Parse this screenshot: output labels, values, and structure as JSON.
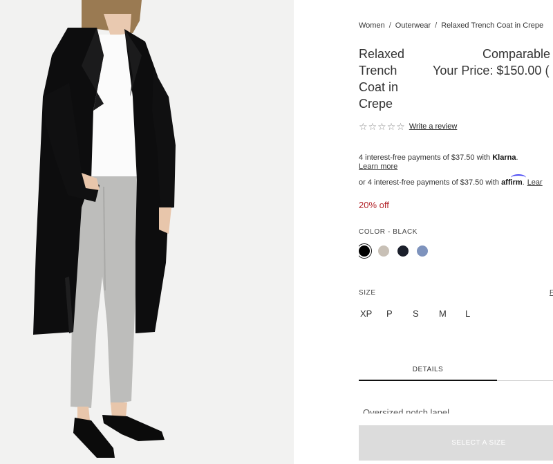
{
  "breadcrumb": {
    "items": [
      "Women",
      "Outerwear",
      "Relaxed Trench Coat in Crepe"
    ],
    "separator": "/"
  },
  "product": {
    "title": "Relaxed Trench Coat in Crepe",
    "comparable_label": "Comparable",
    "your_price_label": "Your Price: $150.00 (",
    "discount": "20% off"
  },
  "rating": {
    "stars": 0,
    "max_stars": 5,
    "write_review_label": "Write a review"
  },
  "payments": {
    "klarna_text": "4 interest-free payments of $37.50 with ",
    "klarna_brand": "Klarna",
    "klarna_suffix": ".",
    "klarna_learn_more": "Learn more",
    "affirm_text": "or 4 interest-free payments of $37.50 with ",
    "affirm_brand": "affirm",
    "affirm_suffix": ".",
    "affirm_learn_more": "Lear"
  },
  "color": {
    "label": "COLOR -",
    "selected": "BLACK",
    "swatches": [
      {
        "name": "black",
        "hex": "#000000",
        "selected": true
      },
      {
        "name": "stone",
        "hex": "#c8c0b6",
        "selected": false
      },
      {
        "name": "navy",
        "hex": "#1b1f2b",
        "selected": false
      },
      {
        "name": "blue",
        "hex": "#7e93bd",
        "selected": false
      }
    ]
  },
  "size": {
    "label": "SIZE",
    "guide_label": "F",
    "options": [
      "XP",
      "P",
      "S",
      "M",
      "L"
    ]
  },
  "tabs": {
    "details_label": "DETAILS"
  },
  "details_preview": "Oversized notch lapel",
  "cta": {
    "select_size_label": "SELECT A SIZE"
  },
  "colors": {
    "discount": "#b4262c",
    "cta_bg": "#dcdcdc",
    "image_bg": "#f2f2f1"
  }
}
